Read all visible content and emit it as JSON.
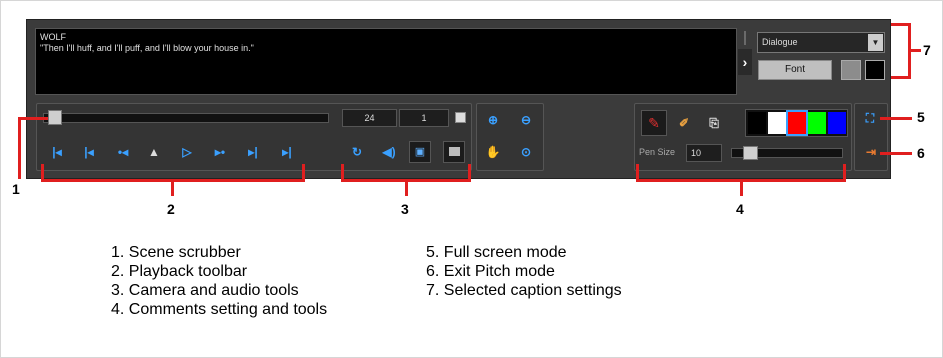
{
  "caption": {
    "speaker": "WOLF",
    "text": "\"Then I'll huff, and I'll puff, and I'll blow your house in.\""
  },
  "caption_settings": {
    "style_select": "Dialogue",
    "font_button": "Font",
    "colors": [
      "#8c8c8c",
      "#000000"
    ]
  },
  "playback": {
    "fps": "24",
    "frame": "1",
    "scrubber_position": 0.02
  },
  "pen": {
    "label": "Pen Size",
    "size": "10",
    "palette": [
      "#000000",
      "#ffffff",
      "#ff0000",
      "#00ff00",
      "#0000ff"
    ]
  },
  "callouts": [
    "1",
    "2",
    "3",
    "4",
    "5",
    "6",
    "7"
  ],
  "legend_left": [
    "1.  Scene scrubber",
    "2.  Playback toolbar",
    "3.  Camera and audio tools",
    "4.  Comments setting and tools"
  ],
  "legend_right": [
    "5.  Full screen mode",
    "6.  Exit Pitch mode",
    "7.  Selected caption settings"
  ]
}
